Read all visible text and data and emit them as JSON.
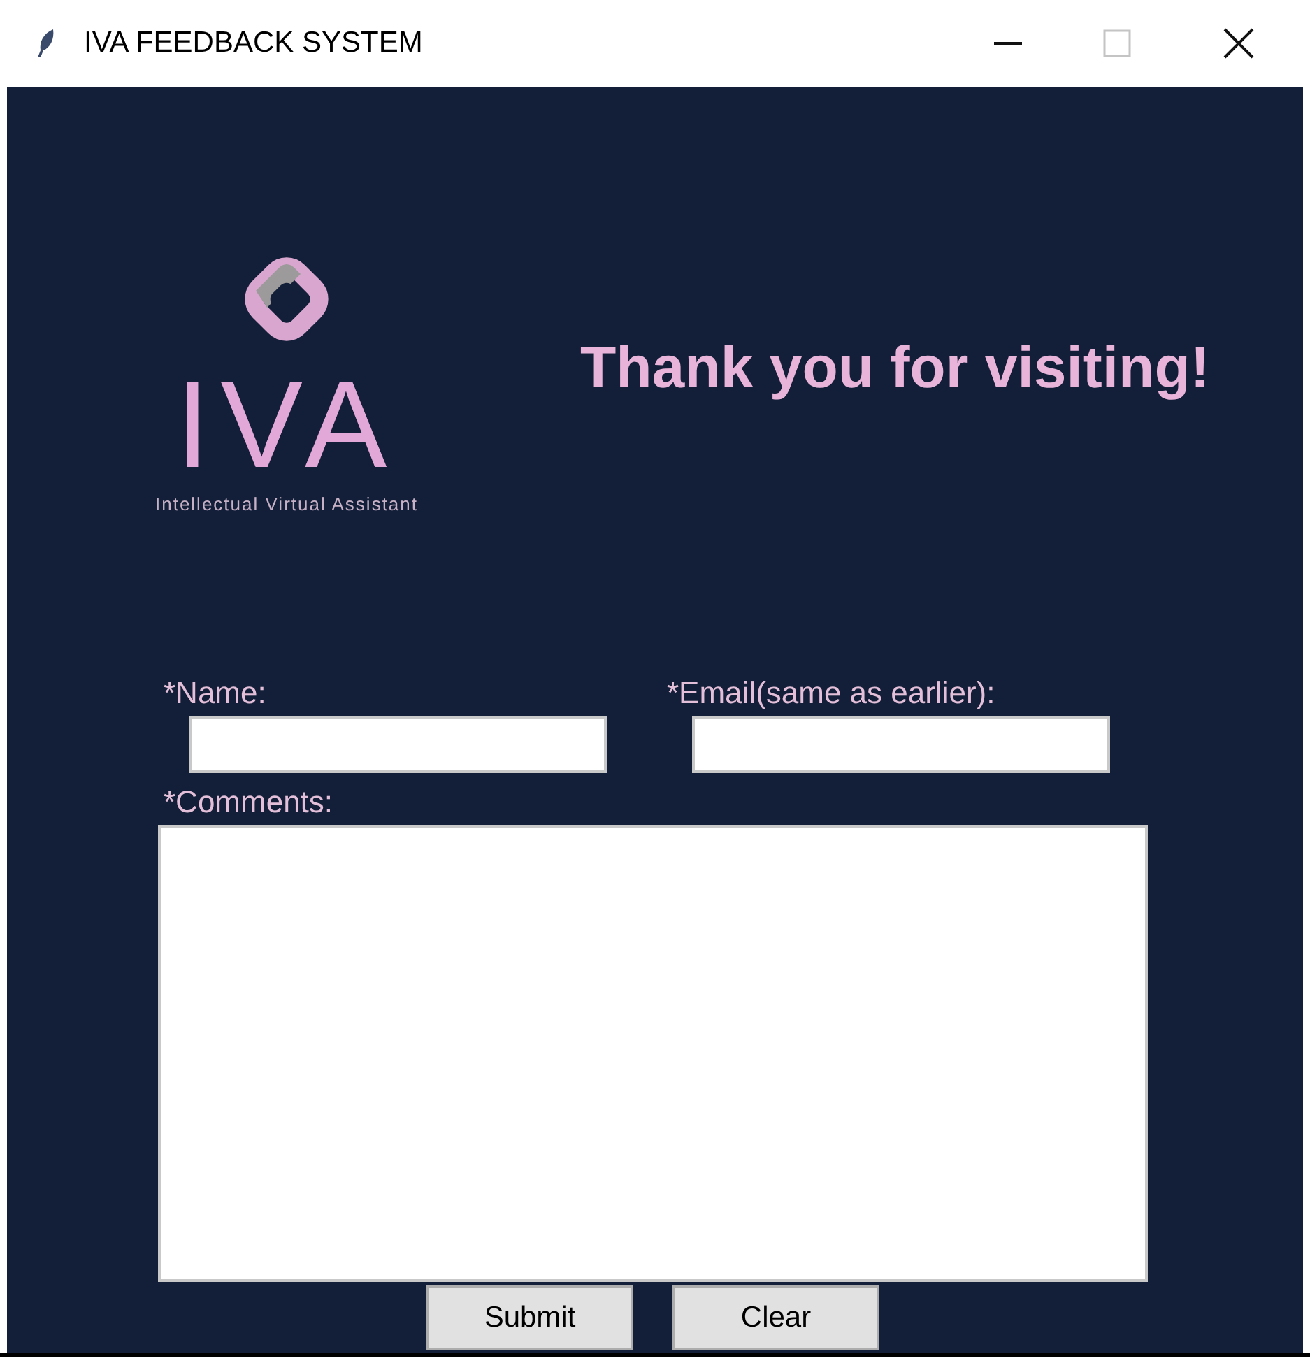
{
  "window": {
    "title": "IVA FEEDBACK SYSTEM"
  },
  "logo": {
    "wordmark": "IVA",
    "tagline": "Intellectual Virtual Assistant"
  },
  "heading": "Thank you for visiting!",
  "form": {
    "fields": [
      {
        "label": "*Name:",
        "kind": "line"
      },
      {
        "label": "*Email(same as earlier):",
        "kind": "line"
      },
      {
        "label": "*Comments:",
        "kind": "area"
      }
    ]
  },
  "buttons": [
    "Submit",
    "Clear"
  ]
}
